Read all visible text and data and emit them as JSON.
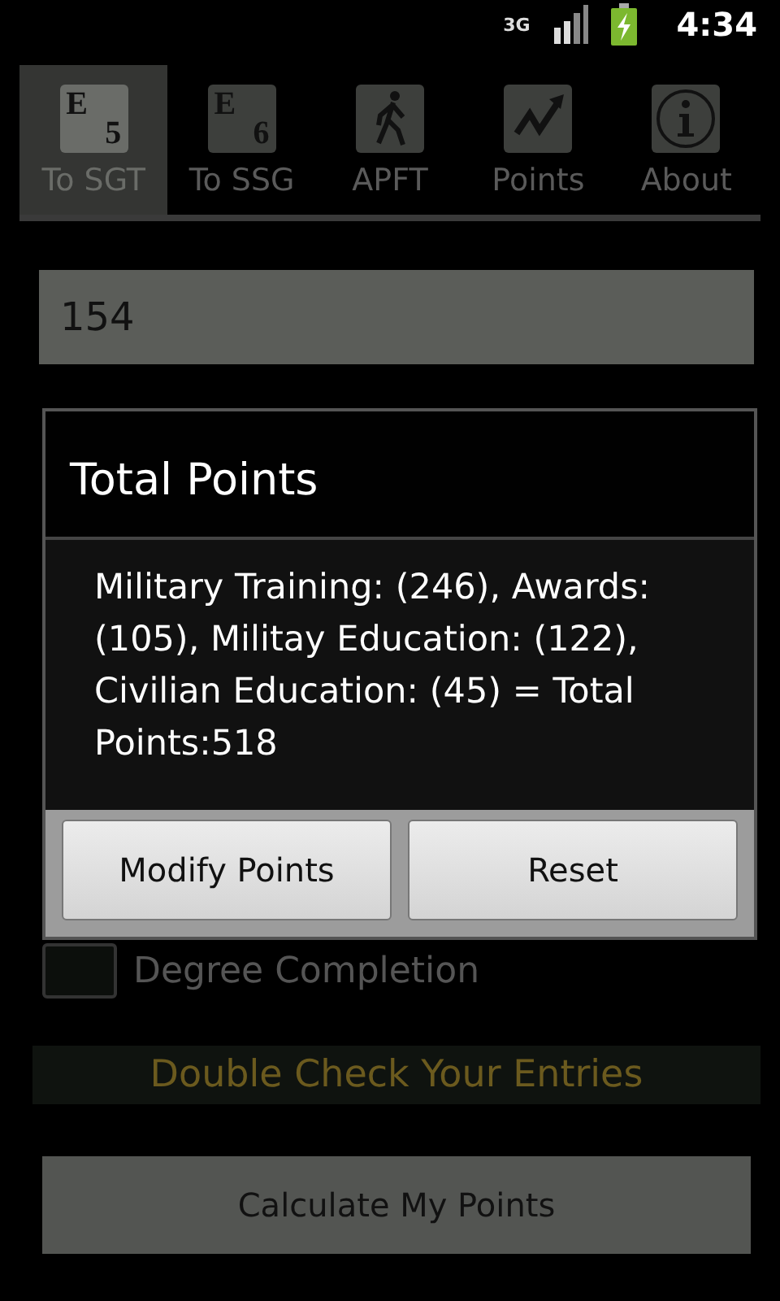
{
  "status_bar": {
    "network": "3G",
    "time": "4:34"
  },
  "tabs": [
    {
      "label": "To SGT",
      "kind": "rank",
      "icon_letter": "E",
      "icon_digit": "5",
      "selected": true
    },
    {
      "label": "To SSG",
      "kind": "rank",
      "icon_letter": "E",
      "icon_digit": "6",
      "selected": false
    },
    {
      "label": "APFT",
      "kind": "walker",
      "selected": false
    },
    {
      "label": "Points",
      "kind": "chart",
      "selected": false
    },
    {
      "label": "About",
      "kind": "info",
      "selected": false
    }
  ],
  "field": {
    "value": "154"
  },
  "degree_checkbox": {
    "label": "Degree Completion",
    "checked": false
  },
  "notice": "Double Check Your Entries",
  "calculate_button": "Calculate My Points",
  "dialog": {
    "title": "Total Points",
    "message": "Military Training: (246), Awards: (105), Militay Education: (122), Civilian Education: (45) = Total Points:518",
    "buttons": [
      "Modify Points",
      "Reset"
    ]
  }
}
